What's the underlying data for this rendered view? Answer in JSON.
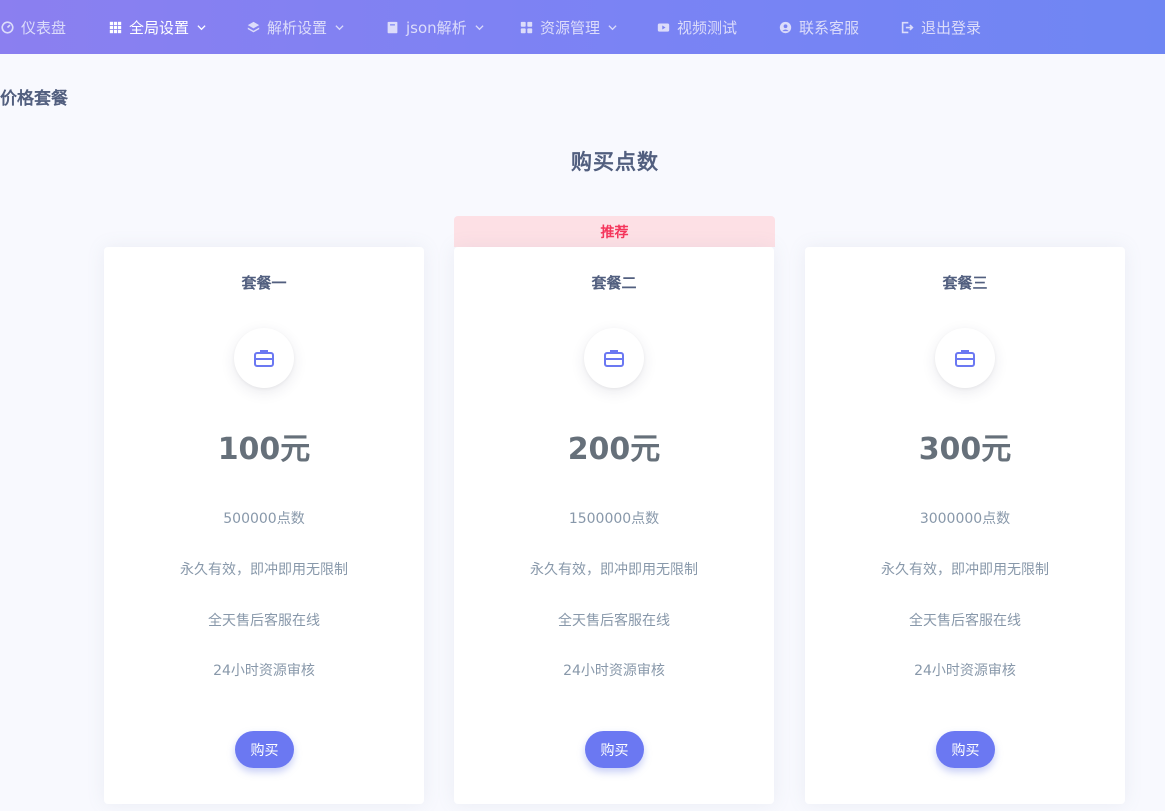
{
  "nav": {
    "items": [
      {
        "label": "仪表盘",
        "icon": "gauge-icon",
        "dropdown": false
      },
      {
        "label": "全局设置",
        "icon": "grid-icon",
        "dropdown": true,
        "active": true
      },
      {
        "label": "解析设置",
        "icon": "layers-icon",
        "dropdown": true
      },
      {
        "label": "json解析",
        "icon": "book-icon",
        "dropdown": true
      },
      {
        "label": "资源管理",
        "icon": "apps-icon",
        "dropdown": true
      },
      {
        "label": "视频测试",
        "icon": "video-icon",
        "dropdown": false
      },
      {
        "label": "联系客服",
        "icon": "user-circle-icon",
        "dropdown": false
      },
      {
        "label": "退出登录",
        "icon": "logout-icon",
        "dropdown": false
      }
    ]
  },
  "page": {
    "title": "价格套餐",
    "section_title": "购买点数"
  },
  "plans": [
    {
      "name": "套餐一",
      "icon": "briefcase-icon",
      "price": "100元",
      "features": [
        "500000点数",
        "永久有效，即冲即用无限制",
        "全天售后客服在线",
        "24小时资源审核"
      ],
      "button": "购买"
    },
    {
      "name": "套餐二",
      "badge": "推荐",
      "icon": "briefcase-icon",
      "price": "200元",
      "features": [
        "1500000点数",
        "永久有效，即冲即用无限制",
        "全天售后客服在线",
        "24小时资源审核"
      ],
      "button": "购买"
    },
    {
      "name": "套餐三",
      "icon": "briefcase-icon",
      "price": "300元",
      "features": [
        "3000000点数",
        "永久有效，即冲即用无限制",
        "全天售后客服在线",
        "24小时资源审核"
      ],
      "button": "购买"
    }
  ],
  "colors": {
    "nav_gradient_start": "#8b7ff0",
    "nav_gradient_end": "#6f86f3",
    "accent": "#6b78f2",
    "badge_bg": "#fde0e5",
    "badge_text": "#f5365c",
    "background": "#f8f9fe"
  }
}
